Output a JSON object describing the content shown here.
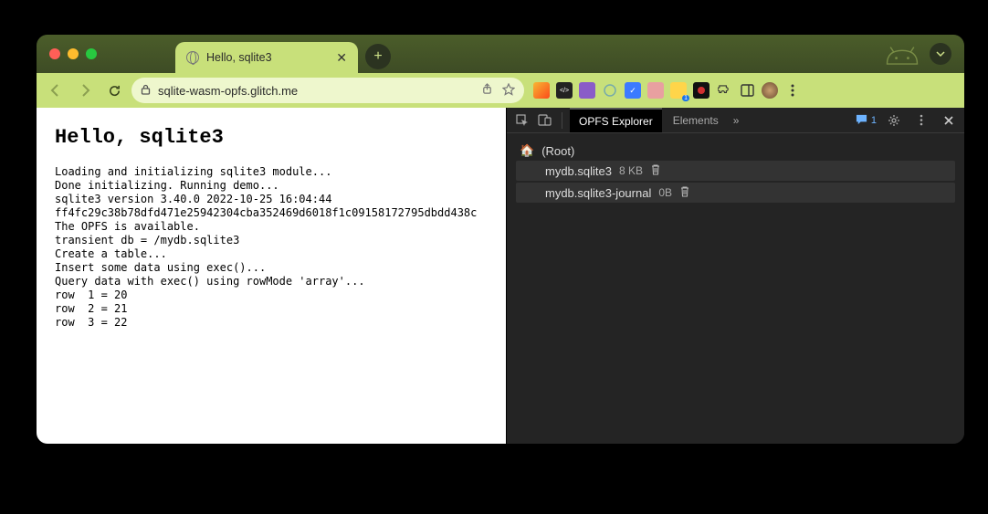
{
  "tab": {
    "title": "Hello, sqlite3"
  },
  "omnibox": {
    "url": "sqlite-wasm-opfs.glitch.me"
  },
  "page": {
    "heading": "Hello, sqlite3",
    "log": "Loading and initializing sqlite3 module...\nDone initializing. Running demo...\nsqlite3 version 3.40.0 2022-10-25 16:04:44\nff4fc29c38b78dfd471e25942304cba352469d6018f1c09158172795dbdd438c\nThe OPFS is available.\ntransient db = /mydb.sqlite3\nCreate a table...\nInsert some data using exec()...\nQuery data with exec() using rowMode 'array'...\nrow  1 = 20\nrow  2 = 21\nrow  3 = 22"
  },
  "devtools": {
    "tabs": {
      "opfs": "OPFS Explorer",
      "elements": "Elements",
      "more": "»"
    },
    "msg_count": "1",
    "tree": {
      "root": "(Root)",
      "files": [
        {
          "name": "mydb.sqlite3",
          "size": "8 KB"
        },
        {
          "name": "mydb.sqlite3-journal",
          "size": "0B"
        }
      ]
    }
  }
}
